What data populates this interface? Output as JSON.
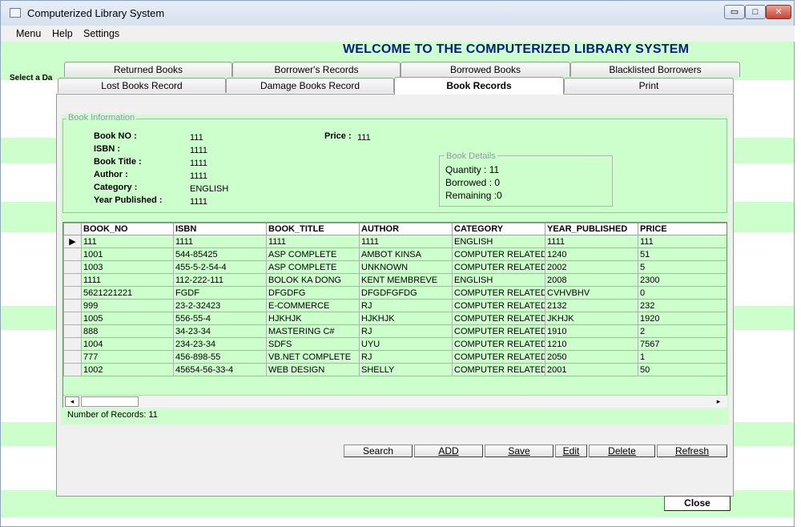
{
  "window": {
    "title": "Computerized Library System",
    "minimize": "▭",
    "maximize": "□",
    "close": "✕"
  },
  "menu": [
    "Menu",
    "Help",
    "Settings"
  ],
  "welcome": "WELCOME TO THE COMPUTERIZED LIBRARY SYSTEM",
  "select_label": "Select a Da",
  "tabs_row1": [
    "Returned Books",
    "Borrower's Records",
    "Borrowed Books",
    "Blacklisted Borrowers"
  ],
  "tabs_row2": [
    "Lost Books Record",
    "Damage Books Record",
    "Book Records",
    "Print"
  ],
  "active_tab": "Book Records",
  "book_info": {
    "legend": "Book Information",
    "book_no_label": "Book NO :",
    "book_no": "111",
    "isbn_label": "ISBN :",
    "isbn": "1111",
    "title_label": "Book Title :",
    "title": "1111",
    "author_label": "Author :",
    "author": "1111",
    "category_label": "Category :",
    "category": "ENGLISH",
    "year_label": "Year Published :",
    "year": "1111",
    "price_label": "Price :",
    "price": "111"
  },
  "book_details": {
    "legend": "Book Details",
    "quantity": "Quantity :  11",
    "borrowed": "Borrowed : 0",
    "remaining": "Remaining :0"
  },
  "grid": {
    "columns": [
      "BOOK_NO",
      "ISBN",
      "BOOK_TITLE",
      "AUTHOR",
      "CATEGORY",
      "YEAR_PUBLISHED",
      "PRICE"
    ],
    "current_row_marker": "▶",
    "rows": [
      [
        "111",
        "1111",
        "1111",
        "1111",
        "ENGLISH",
        "1111",
        "111"
      ],
      [
        "1001",
        "544-85425",
        "ASP COMPLETE",
        "AMBOT KINSA",
        "COMPUTER RELATED BOOKS",
        "1240",
        "51"
      ],
      [
        "1003",
        "455-5-2-54-4",
        "ASP COMPLETE",
        "UNKNOWN",
        "COMPUTER RELATED BOOKS",
        "2002",
        "5"
      ],
      [
        "1111",
        "112-222-111",
        "BOLOK KA DONG",
        "KENT MEMBREVE",
        "ENGLISH",
        "2008",
        "2300"
      ],
      [
        "5621221221",
        "FGDF",
        "DFGDFG",
        "DFGDFGFDG",
        "COMPUTER RELATED BOOKS",
        "CVHVBHV",
        "0"
      ],
      [
        "999",
        "23-2-32423",
        "E-COMMERCE",
        "RJ",
        "COMPUTER RELATED BOOKS",
        "2132",
        "232"
      ],
      [
        "1005",
        "556-55-4",
        "HJKHJK",
        "HJKHJK",
        "COMPUTER RELATED BOOKS",
        "JKHJK",
        "1920"
      ],
      [
        "888",
        "34-23-34",
        "MASTERING C#",
        "RJ",
        "COMPUTER RELATED BOOKS",
        "1910",
        "2"
      ],
      [
        "1004",
        "234-23-34",
        "SDFS",
        "UYU",
        "COMPUTER RELATED BOOKS",
        "1210",
        "7567"
      ],
      [
        "777",
        "456-898-55",
        "VB.NET COMPLETE",
        "RJ",
        "COMPUTER RELATED BOOKS",
        "2050",
        "1"
      ],
      [
        "1002",
        "45654-56-33-4",
        "WEB DESIGN",
        "SHELLY",
        "COMPUTER RELATED BOOKS",
        "2001",
        "50"
      ]
    ],
    "scroll_left": "◂",
    "scroll_right": "▸"
  },
  "record_count": "Number of Records: 11",
  "buttons": {
    "search": "Search",
    "add": "ADD",
    "save": "Save",
    "edit": "Edit",
    "delete": "Delete",
    "refresh": "Refresh",
    "close": "Close"
  },
  "colors": {
    "panel_green": "#ccffcc",
    "title_blue": "#0a1a8c"
  }
}
